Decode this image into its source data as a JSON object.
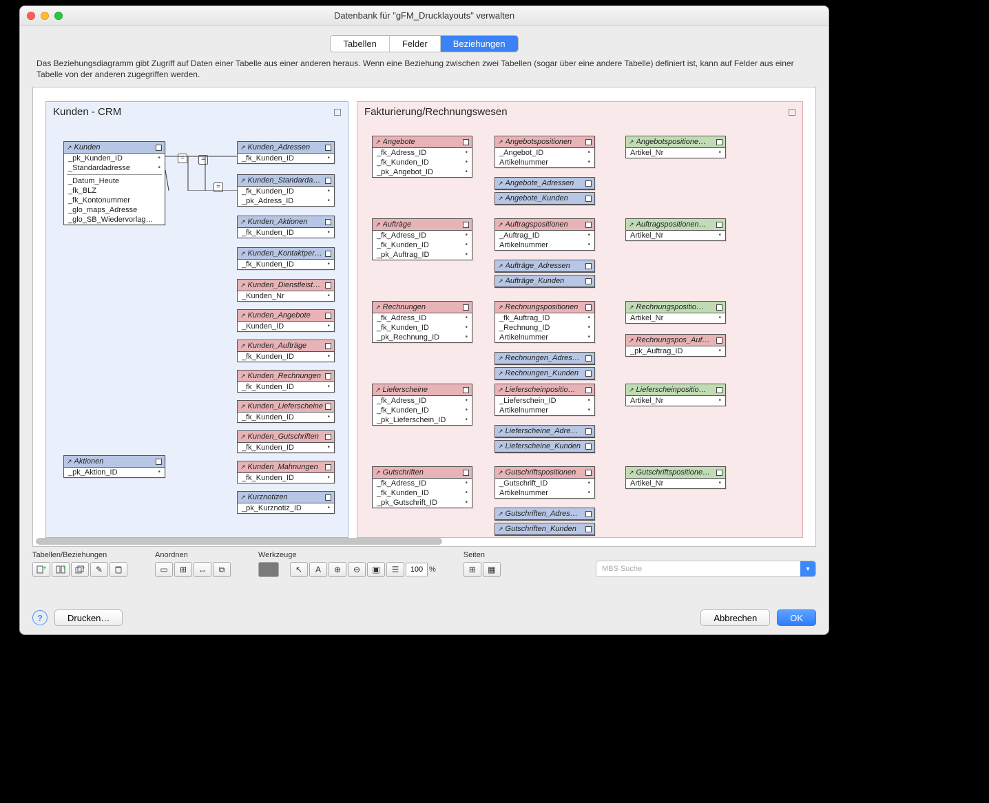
{
  "window_title": "Datenbank für \"gFM_Drucklayouts\" verwalten",
  "tabs": {
    "tables": "Tabellen",
    "fields": "Felder",
    "relations": "Beziehungen"
  },
  "description": "Das Beziehungsdiagramm gibt Zugriff auf Daten einer Tabelle aus einer anderen heraus. Wenn eine Beziehung zwischen zwei Tabellen (sogar über eine andere Tabelle) definiert ist, kann auf Felder aus einer Tabelle von der anderen zugegriffen werden.",
  "groups": {
    "crm": "Kunden - CRM",
    "billing": "Fakturierung/Rechnungswesen"
  },
  "tables": {
    "kunden": {
      "name": "Kunden",
      "fields": [
        "_pk_Kunden_ID",
        "_Standardadresse"
      ],
      "extra": [
        "_Datum_Heute",
        "_fk_BLZ",
        "_fk_Kontonummer",
        "_glo_maps_Adresse",
        "_glo_SB_Wiedervorlag…"
      ]
    },
    "aktionen": {
      "name": "Aktionen",
      "fields": [
        "_pk_Aktion_ID"
      ]
    },
    "kadr": {
      "name": "Kunden_Adressen",
      "fields": [
        "_fk_Kunden_ID"
      ]
    },
    "kstd": {
      "name": "Kunden_Standarda…",
      "fields": [
        "_fk_Kunden_ID",
        "_pk_Adress_ID"
      ]
    },
    "kakt": {
      "name": "Kunden_Aktionen",
      "fields": [
        "_fk_Kunden_ID"
      ]
    },
    "kkon": {
      "name": "Kunden_Kontaktper…",
      "fields": [
        "_fk_Kunden_ID"
      ]
    },
    "kdie": {
      "name": "Kunden_Dienstleist…",
      "fields": [
        "_Kunden_Nr"
      ]
    },
    "kang": {
      "name": "Kunden_Angebote",
      "fields": [
        "_Kunden_ID"
      ]
    },
    "kauf": {
      "name": "Kunden_Aufträge",
      "fields": [
        "_fk_Kunden_ID"
      ]
    },
    "krec": {
      "name": "Kunden_Rechnungen",
      "fields": [
        "_fk_Kunden_ID"
      ]
    },
    "klie": {
      "name": "Kunden_Lieferscheine",
      "fields": [
        "_fk_Kunden_ID"
      ]
    },
    "kgut": {
      "name": "Kunden_Gutschriften",
      "fields": [
        "_fk_Kunden_ID"
      ]
    },
    "kmah": {
      "name": "Kunden_Mahnungen",
      "fields": [
        "_fk_Kunden_ID"
      ]
    },
    "kurz": {
      "name": "Kurznotizen",
      "fields": [
        "_pk_Kurznotiz_ID"
      ]
    },
    "ang": {
      "name": "Angebote",
      "fields": [
        "_fk_Adress_ID",
        "_fk_Kunden_ID",
        "_pk_Angebot_ID"
      ]
    },
    "angpos": {
      "name": "Angebotspositionen",
      "fields": [
        "_Angebot_ID",
        "Artikelnummer"
      ]
    },
    "angadr": {
      "name": "Angebote_Adressen"
    },
    "angkun": {
      "name": "Angebote_Kunden"
    },
    "angposart": {
      "name": "Angebotspositione…",
      "fields": [
        "Artikel_Nr"
      ]
    },
    "auf": {
      "name": "Aufträge",
      "fields": [
        "_fk_Adress_ID",
        "_fk_Kunden_ID",
        "_pk_Auftrag_ID"
      ]
    },
    "aufpos": {
      "name": "Auftragspositionen",
      "fields": [
        "_Auftrag_ID",
        "Artikelnummer"
      ]
    },
    "aufadr": {
      "name": "Aufträge_Adressen"
    },
    "aufkun": {
      "name": "Aufträge_Kunden"
    },
    "aufposart": {
      "name": "Auftragspositionen…",
      "fields": [
        "Artikel_Nr"
      ]
    },
    "rec": {
      "name": "Rechnungen",
      "fields": [
        "_fk_Adress_ID",
        "_fk_Kunden_ID",
        "_pk_Rechnung_ID"
      ]
    },
    "recpos": {
      "name": "Rechnungspositionen",
      "fields": [
        "_fk_Auftrag_ID",
        "_Rechnung_ID",
        "Artikelnummer"
      ]
    },
    "recadr": {
      "name": "Rechnungen_Adres…"
    },
    "reckun": {
      "name": "Rechnungen_Kunden"
    },
    "recposart": {
      "name": "Rechnungspositio…",
      "fields": [
        "Artikel_Nr"
      ]
    },
    "recposauf": {
      "name": "Rechnungspos_Auf…",
      "fields": [
        "_pk_Auftrag_ID"
      ]
    },
    "lie": {
      "name": "Lieferscheine",
      "fields": [
        "_fk_Adress_ID",
        "_fk_Kunden_ID",
        "_pk_Lieferschein_ID"
      ]
    },
    "liepos": {
      "name": "Lieferscheinpositio…",
      "fields": [
        "_Lieferschein_ID",
        "Artikelnummer"
      ]
    },
    "lieadr": {
      "name": "Lieferscheine_Adre…"
    },
    "liekun": {
      "name": "Lieferscheine_Kunden"
    },
    "lieposart": {
      "name": "Lieferscheinpositio…",
      "fields": [
        "Artikel_Nr"
      ]
    },
    "gut": {
      "name": "Gutschriften",
      "fields": [
        "_fk_Adress_ID",
        "_fk_Kunden_ID",
        "_pk_Gutschrift_ID"
      ]
    },
    "gutpos": {
      "name": "Gutschriftspositionen",
      "fields": [
        "_Gutschrift_ID",
        "Artikelnummer"
      ]
    },
    "gutadr": {
      "name": "Gutschriften_Adres…"
    },
    "gutkun": {
      "name": "Gutschriften_Kunden"
    },
    "gutposart": {
      "name": "Gutschriftspositione…",
      "fields": [
        "Artikel_Nr"
      ]
    }
  },
  "toolbar": {
    "g1": "Tabellen/Beziehungen",
    "g2": "Anordnen",
    "g3": "Werkzeuge",
    "g4": "Seiten",
    "zoom": "100",
    "zoom_unit": "%",
    "search_ph": "MBS Suche"
  },
  "footer": {
    "help": "?",
    "print": "Drucken…",
    "cancel": "Abbrechen",
    "ok": "OK"
  }
}
